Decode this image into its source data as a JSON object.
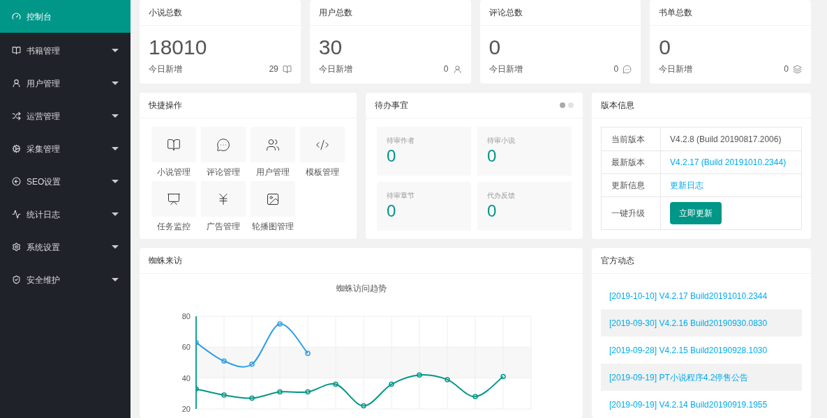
{
  "sidebar": {
    "items": [
      {
        "label": "控制台",
        "selected": true,
        "has_submenu": false
      },
      {
        "label": "书籍管理",
        "selected": false,
        "has_submenu": true
      },
      {
        "label": "用户管理",
        "selected": false,
        "has_submenu": true
      },
      {
        "label": "运营管理",
        "selected": false,
        "has_submenu": true
      },
      {
        "label": "采集管理",
        "selected": false,
        "has_submenu": true
      },
      {
        "label": "SEO设置",
        "selected": false,
        "has_submenu": true
      },
      {
        "label": "统计日志",
        "selected": false,
        "has_submenu": true
      },
      {
        "label": "系统设置",
        "selected": false,
        "has_submenu": true
      },
      {
        "label": "安全维护",
        "selected": false,
        "has_submenu": true
      }
    ]
  },
  "stats": [
    {
      "title": "小说总数",
      "value": "18010",
      "footer_label": "今日新增",
      "footer_count": "29"
    },
    {
      "title": "用户总数",
      "value": "30",
      "footer_label": "今日新增",
      "footer_count": "0"
    },
    {
      "title": "评论总数",
      "value": "0",
      "footer_label": "今日新增",
      "footer_count": "0"
    },
    {
      "title": "书单总数",
      "value": "0",
      "footer_label": "今日新增",
      "footer_count": "0"
    }
  ],
  "quick_actions": {
    "title": "快捷操作",
    "items": [
      "小说管理",
      "评论管理",
      "用户管理",
      "模板管理",
      "任务监控",
      "广告管理",
      "轮播图管理"
    ]
  },
  "todo": {
    "title": "待办事宜",
    "pager": [
      {
        "selected": true
      },
      {
        "selected": false
      }
    ],
    "items": [
      {
        "label": "待审作者",
        "value": "0"
      },
      {
        "label": "待审小说",
        "value": "0"
      },
      {
        "label": "待审章节",
        "value": "0"
      },
      {
        "label": "代办反馈",
        "value": "0"
      }
    ]
  },
  "version": {
    "title": "版本信息",
    "rows": [
      {
        "kind": "text",
        "label": "当前版本",
        "value": "V4.2.8 (Build 20190817.2006)"
      },
      {
        "kind": "link",
        "label": "最新版本",
        "value": "V4.2.17 (Build 20191010.2344)"
      },
      {
        "kind": "link",
        "label": "更新信息",
        "value": "更新日志"
      },
      {
        "kind": "button",
        "label": "一键升级",
        "value": "立即更新"
      }
    ]
  },
  "spider": {
    "title": "蜘蛛来访",
    "chart_data": {
      "type": "line",
      "title": "蜘蛛访问趋势",
      "grid": true,
      "bands": [
        {
          "axis": "y",
          "from": 40,
          "to": 60
        }
      ],
      "ylim": [
        20,
        80
      ],
      "yticks": [
        20,
        40,
        60,
        80
      ],
      "series": [
        {
          "color": "#2d9ee8",
          "marker": true,
          "values": [
            63,
            51,
            49,
            75,
            56,
            null,
            null,
            null,
            null,
            null,
            null,
            null,
            null
          ]
        },
        {
          "color": "#009688",
          "marker": true,
          "values": [
            33,
            29,
            27,
            31,
            31,
            36,
            22,
            36,
            42,
            39,
            28,
            41,
            null
          ]
        }
      ]
    }
  },
  "news": {
    "title": "官方动态",
    "items": [
      "[2019-10-10] V4.2.17 Build20191010.2344",
      "[2019-09-30] V4.2.16 Build20190930.0830",
      "[2019-09-28] V4.2.15 Build20190928.1030",
      "[2019-09-19] PT小说程序4.2停售公告",
      "[2019-09-19] V4.2.14 Build20190919.1955"
    ]
  }
}
